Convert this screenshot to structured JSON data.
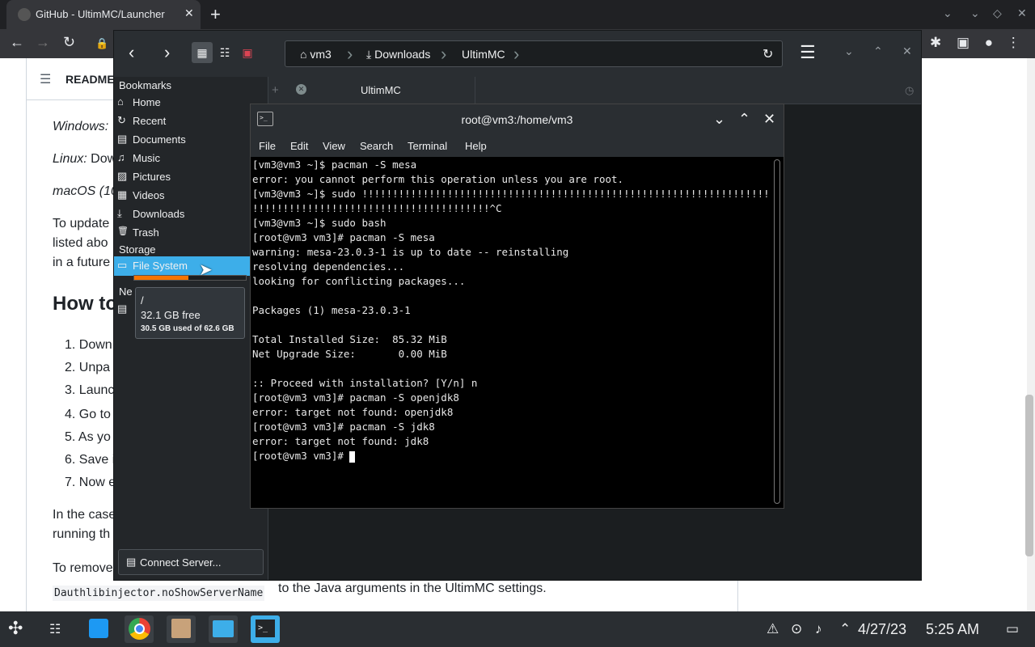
{
  "browser": {
    "tab_title": "GitHub - UltimMC/Launcher",
    "tab_close": "✕",
    "new_tab": "+"
  },
  "page": {
    "readme_label": "README",
    "lines": [
      {
        "text": "Windows: ",
        "italic": true
      },
      {
        "text": "Linux:",
        "rest": " Dow"
      },
      {
        "text": "macOS (10"
      }
    ],
    "para1": [
      "To update",
      "listed abo",
      "in a future"
    ],
    "heading": "How to",
    "steps": [
      "1. Down",
      "2. Unpa",
      "3. Launc",
      "4. Go to",
      "5. As yo",
      "6. Save i",
      "7. Now e"
    ],
    "para2": [
      "In the case",
      "running th"
    ],
    "para3": "To remove",
    "code": "Dauthlibinjector.noShowServerName",
    "after_code": " to the Java arguments in the UltimMC settings."
  },
  "dolphin": {
    "breadcrumb": [
      "vm3",
      "Downloads",
      "UltimMC"
    ],
    "bookmarks_header": "Bookmarks",
    "bookmarks": [
      {
        "label": "Home",
        "icon": "home-icon",
        "glyph": "⌂"
      },
      {
        "label": "Recent",
        "icon": "recent-icon",
        "glyph": "↻"
      },
      {
        "label": "Documents",
        "icon": "documents-icon",
        "glyph": "▤"
      },
      {
        "label": "Music",
        "icon": "music-icon",
        "glyph": "♫"
      },
      {
        "label": "Pictures",
        "icon": "pictures-icon",
        "glyph": "▨"
      },
      {
        "label": "Videos",
        "icon": "videos-icon",
        "glyph": "▦"
      },
      {
        "label": "Downloads",
        "icon": "downloads-icon",
        "glyph": "⤓"
      },
      {
        "label": "Trash",
        "icon": "trash-icon",
        "glyph": "🗑"
      }
    ],
    "storage_header": "Storage",
    "filesystem_label": "File System",
    "filesystem_used_fraction": 0.487,
    "network_header_partial": "Ne",
    "tooltip": {
      "path": "/",
      "free": "32.1 GB free",
      "usage": "30.5 GB used of 62.6 GB"
    },
    "connect_server": "Connect Server...",
    "tab_label": "UltimMC"
  },
  "terminal": {
    "title": "root@vm3:/home/vm3",
    "menu": [
      "File",
      "Edit",
      "View",
      "Search",
      "Terminal",
      "Help"
    ],
    "lines": [
      "[vm3@vm3 ~]$ pacman -S mesa",
      "error: you cannot perform this operation unless you are root.",
      "[vm3@vm3 ~]$ sudo !!!!!!!!!!!!!!!!!!!!!!!!!!!!!!!!!!!!!!!!!!!!!!!!!!!!!!!!!!!!!!!!!!!!",
      "!!!!!!!!!!!!!!!!!!!!!!!!!!!!!!!!!!!!!!!^C",
      "[vm3@vm3 ~]$ sudo bash",
      "[root@vm3 vm3]# pacman -S mesa",
      "warning: mesa-23.0.3-1 is up to date -- reinstalling",
      "resolving dependencies...",
      "looking for conflicting packages...",
      "",
      "Packages (1) mesa-23.0.3-1",
      "",
      "Total Installed Size:  85.32 MiB",
      "Net Upgrade Size:       0.00 MiB",
      "",
      ":: Proceed with installation? [Y/n] n",
      "[root@vm3 vm3]# pacman -S openjdk8",
      "error: target not found: openjdk8",
      "[root@vm3 vm3]# pacman -S jdk8",
      "error: target not found: jdk8",
      "[root@vm3 vm3]# "
    ]
  },
  "taskbar": {
    "date": "4/27/23",
    "time": "5:25 AM"
  }
}
